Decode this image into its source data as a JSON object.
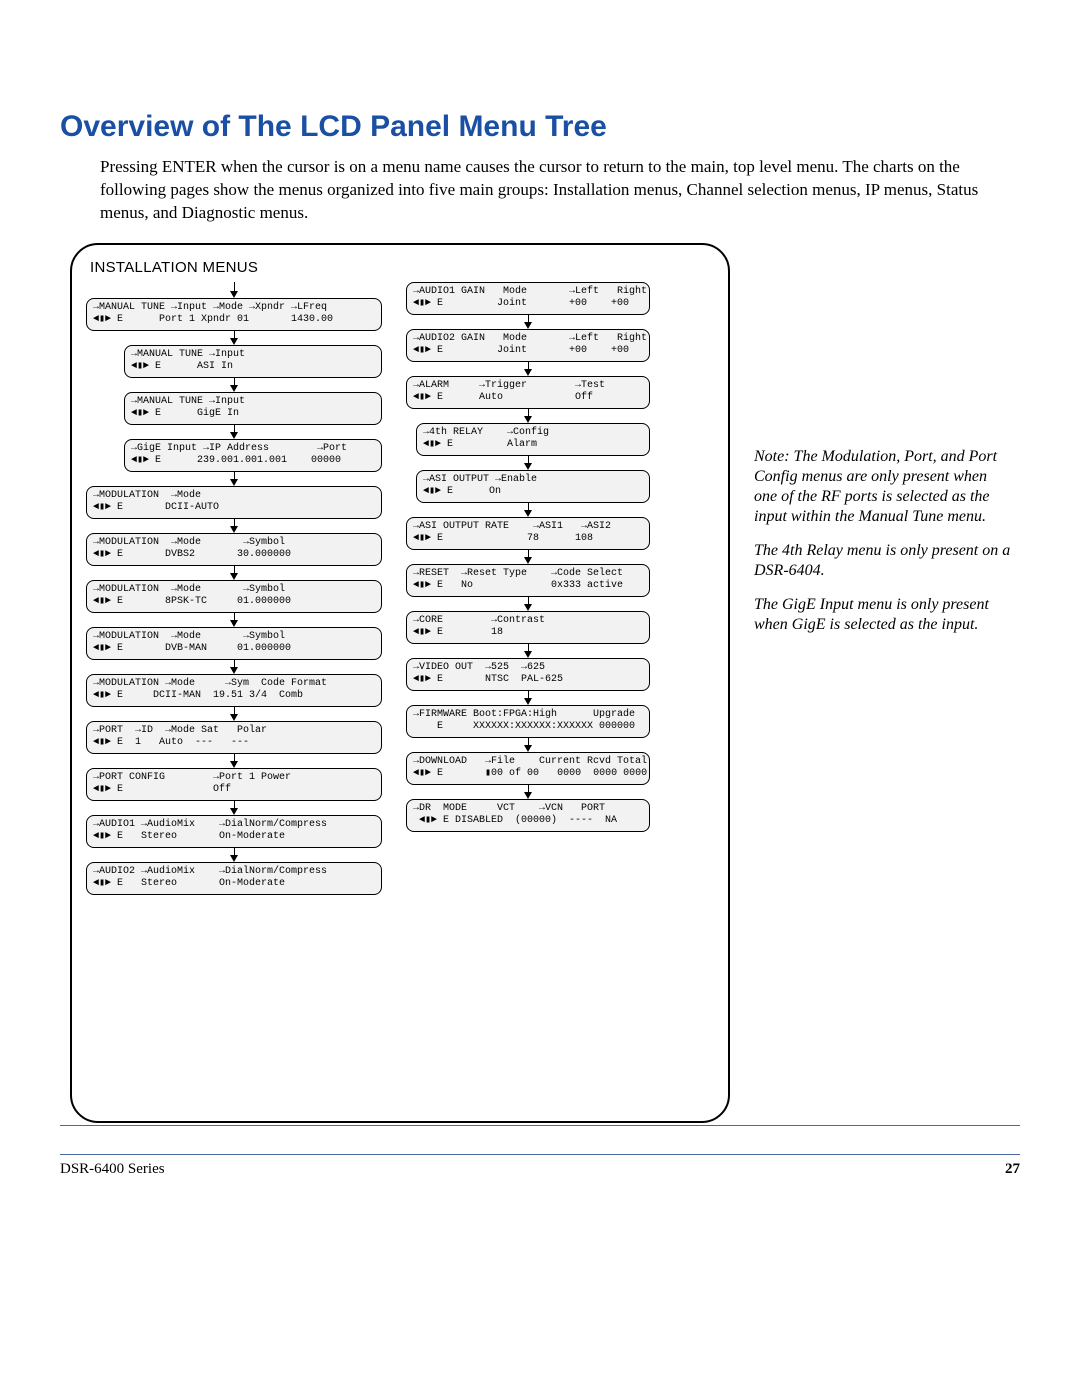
{
  "title": "Overview of The LCD Panel Menu Tree",
  "intro": "Pressing ENTER when the cursor is on a menu name causes the cursor to return to the main, top level menu. The charts on the following pages show the menus organized into five main groups: Installation menus, Channel selection menus, IP menus, Status menus, and Diagnostic menus.",
  "diagram_title": "INSTALLATION MENUS",
  "left": [
    {
      "cls": "wide",
      "t": "→MANUAL TUNE →Input →Mode →Xpndr →LFreq\n◄▮► E      Port 1 Xpndr 01       1430.00"
    },
    {
      "cls": "mid",
      "t": "→MANUAL TUNE →Input\n◄▮► E      ASI In"
    },
    {
      "cls": "mid",
      "t": "→MANUAL TUNE →Input\n◄▮► E      GigE In"
    },
    {
      "cls": "mid",
      "t": "→GigE Input →IP Address        →Port\n◄▮► E      239.001.001.001    00000"
    },
    {
      "cls": "wide",
      "t": "→MODULATION  →Mode\n◄▮► E       DCII-AUTO"
    },
    {
      "cls": "wide",
      "t": "→MODULATION  →Mode       →Symbol\n◄▮► E       DVBS2       30.000000"
    },
    {
      "cls": "wide",
      "t": "→MODULATION  →Mode       →Symbol\n◄▮► E       8PSK-TC     01.000000"
    },
    {
      "cls": "wide",
      "t": "→MODULATION  →Mode       →Symbol\n◄▮► E       DVB-MAN     01.000000"
    },
    {
      "cls": "wide",
      "t": "→MODULATION →Mode     →Sym  Code Format\n◄▮► E     DCII-MAN  19.51 3/4  Comb"
    },
    {
      "cls": "wide",
      "t": "→PORT  →ID  →Mode Sat   Polar\n◄▮► E  1   Auto  ---   ---"
    },
    {
      "cls": "wide",
      "t": "→PORT CONFIG        →Port 1 Power\n◄▮► E               Off"
    },
    {
      "cls": "wide",
      "t": "→AUDIO1 →AudioMix    →DialNorm/Compress\n◄▮► E   Stereo       On-Moderate"
    },
    {
      "cls": "wide",
      "t": "→AUDIO2 →AudioMix    →DialNorm/Compress\n◄▮► E   Stereo       On-Moderate"
    }
  ],
  "right": [
    {
      "cls": "nar",
      "t": "→AUDIO1 GAIN   Mode       →Left   Right\n◄▮► E         Joint       +00    +00"
    },
    {
      "cls": "nar",
      "t": "→AUDIO2 GAIN   Mode       →Left   Right\n◄▮► E         Joint       +00    +00"
    },
    {
      "cls": "nar",
      "t": "→ALARM     →Trigger        →Test\n◄▮► E      Auto            Off"
    },
    {
      "cls": "nar-in",
      "t": "→4th RELAY    →Config\n◄▮► E         Alarm"
    },
    {
      "cls": "nar-in",
      "t": "→ASI OUTPUT →Enable\n◄▮► E      On"
    },
    {
      "cls": "nar",
      "t": "→ASI OUTPUT RATE    →ASI1   →ASI2\n◄▮► E              78      108"
    },
    {
      "cls": "nar",
      "t": "→RESET  →Reset Type    →Code Select\n◄▮► E   No             0x333 active"
    },
    {
      "cls": "nar",
      "t": "→CORE        →Contrast\n◄▮► E        18"
    },
    {
      "cls": "nar",
      "t": "→VIDEO OUT  →525  →625\n◄▮► E       NTSC  PAL-625"
    },
    {
      "cls": "nar",
      "t": "→FIRMWARE Boot:FPGA:High      Upgrade\n    E     XXXXXX:XXXXXX:XXXXXX 000000"
    },
    {
      "cls": "nar",
      "t": "→DOWNLOAD   →File    Current Rcvd Total\n◄▮► E       ▮00 of 00   0000  0000 0000"
    },
    {
      "cls": "nar",
      "t": "→DR  MODE     VCT    →VCN   PORT\n ◄▮► E DISABLED  (00000)  ----  NA"
    }
  ],
  "notes": [
    "Note:   The Modulation, Port, and Port Config menus are only present when one of the RF ports is selected as the input within the Manual Tune menu.",
    "The 4th Relay menu is only present on a DSR-6404.",
    "The GigE Input menu is only present when GigE is selected as the input."
  ],
  "footer_series": "DSR-6400 Series",
  "footer_page": "27"
}
